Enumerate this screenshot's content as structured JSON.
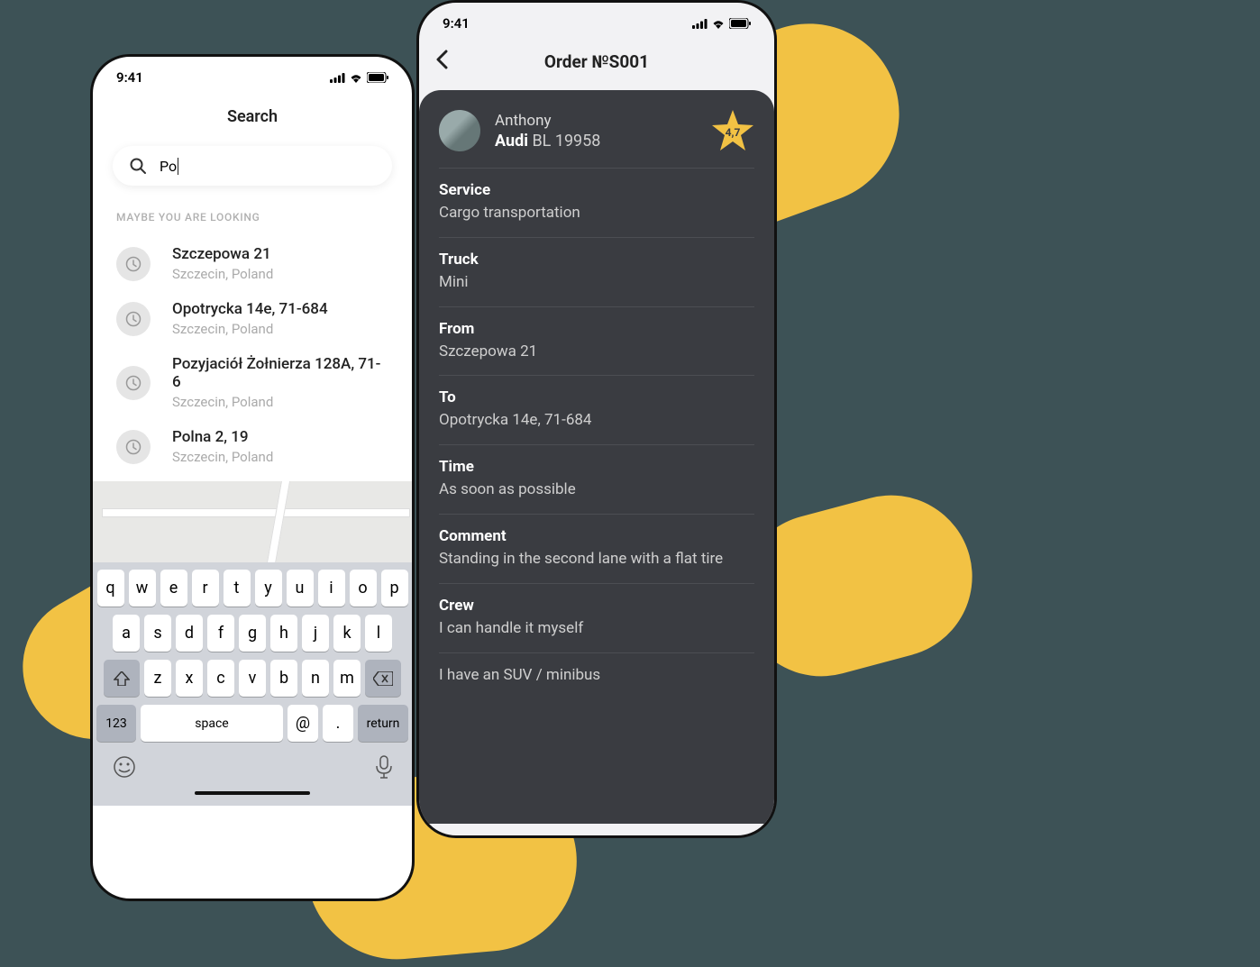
{
  "statusTime": "9:41",
  "searchPhone": {
    "title": "Search",
    "query": "Po",
    "hint": "MAYBE YOU ARE LOOKING",
    "suggestions": [
      {
        "title": "Szczepowa 21",
        "sub": "Szczecin, Poland"
      },
      {
        "title": "Opotrycka 14e, 71-684",
        "sub": "Szczecin, Poland"
      },
      {
        "title": "Pozyjaciół Żołnierza 128A, 71-6",
        "sub": "Szczecin, Poland"
      },
      {
        "title": "Polna 2, 19",
        "sub": "Szczecin, Poland"
      }
    ]
  },
  "keyboard": {
    "row1": [
      "q",
      "w",
      "e",
      "r",
      "t",
      "y",
      "u",
      "i",
      "o",
      "p"
    ],
    "row2": [
      "a",
      "s",
      "d",
      "f",
      "g",
      "h",
      "j",
      "k",
      "l"
    ],
    "row3": [
      "z",
      "x",
      "c",
      "v",
      "b",
      "n",
      "m"
    ],
    "numKey": "123",
    "spaceKey": "space",
    "atKey": "@",
    "dotKey": ".",
    "returnKey": "return"
  },
  "orderPhone": {
    "title": "Order №S001",
    "driver": {
      "name": "Anthony",
      "carBrand": "Audi",
      "carPlate": "BL 19958",
      "rating": "4,7"
    },
    "details": [
      {
        "label": "Service",
        "value": "Cargo transportation"
      },
      {
        "label": "Truck",
        "value": "Mini"
      },
      {
        "label": "From",
        "value": "Szczepowa 21"
      },
      {
        "label": "To",
        "value": "Opotrycka 14e, 71-684"
      },
      {
        "label": "Time",
        "value": "As soon as possible"
      },
      {
        "label": "Comment",
        "value": "Standing in the second lane with a flat tire"
      },
      {
        "label": "Crew",
        "value": "I can handle it myself"
      }
    ],
    "extra": "I have an SUV / minibus"
  }
}
